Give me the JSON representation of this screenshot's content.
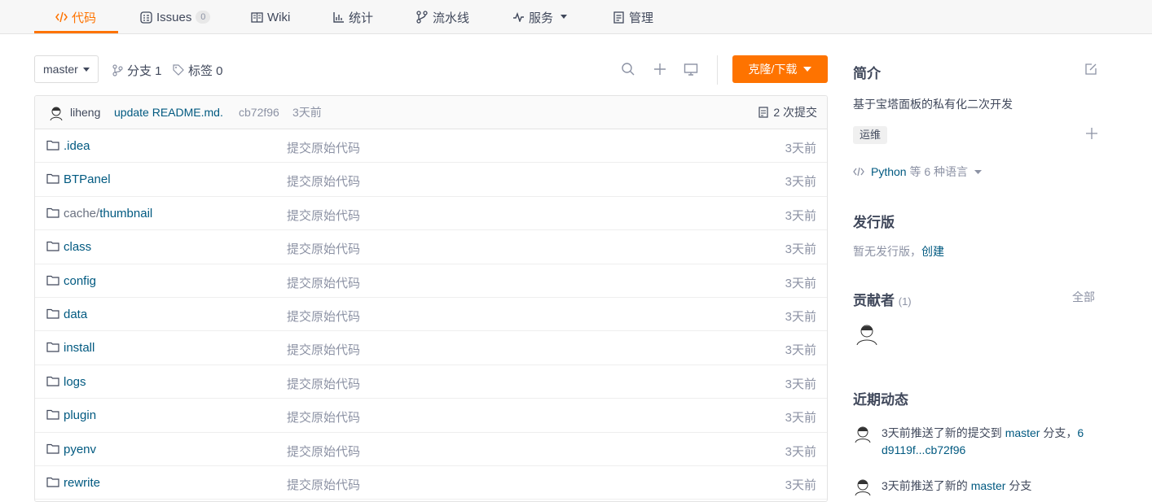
{
  "tabs": [
    {
      "label": "代码",
      "icon": "code-icon",
      "active": true
    },
    {
      "label": "Issues",
      "icon": "issues-icon",
      "badge": "0"
    },
    {
      "label": "Wiki",
      "icon": "wiki-icon"
    },
    {
      "label": "统计",
      "icon": "stats-icon"
    },
    {
      "label": "流水线",
      "icon": "pipeline-icon"
    },
    {
      "label": "服务",
      "icon": "service-icon",
      "dropdown": true
    },
    {
      "label": "管理",
      "icon": "manage-icon"
    }
  ],
  "toolbar": {
    "branch": "master",
    "branches_label": "分支 1",
    "tags_label": "标签 0",
    "clone_label": "克隆/下载"
  },
  "commit": {
    "author": "liheng",
    "message": "update README.md.",
    "sha": "cb72f96",
    "time": "3天前",
    "count_label": "2 次提交"
  },
  "files": [
    {
      "name": ".idea",
      "prefix": "",
      "message": "提交原始代码",
      "time": "3天前"
    },
    {
      "name": "BTPanel",
      "prefix": "",
      "message": "提交原始代码",
      "time": "3天前"
    },
    {
      "name": "thumbnail",
      "prefix": "cache/",
      "message": "提交原始代码",
      "time": "3天前"
    },
    {
      "name": "class",
      "prefix": "",
      "message": "提交原始代码",
      "time": "3天前"
    },
    {
      "name": "config",
      "prefix": "",
      "message": "提交原始代码",
      "time": "3天前"
    },
    {
      "name": "data",
      "prefix": "",
      "message": "提交原始代码",
      "time": "3天前"
    },
    {
      "name": "install",
      "prefix": "",
      "message": "提交原始代码",
      "time": "3天前"
    },
    {
      "name": "logs",
      "prefix": "",
      "message": "提交原始代码",
      "time": "3天前"
    },
    {
      "name": "plugin",
      "prefix": "",
      "message": "提交原始代码",
      "time": "3天前"
    },
    {
      "name": "pyenv",
      "prefix": "",
      "message": "提交原始代码",
      "time": "3天前"
    },
    {
      "name": "rewrite",
      "prefix": "",
      "message": "提交原始代码",
      "time": "3天前"
    }
  ],
  "sidebar": {
    "intro_title": "简介",
    "intro_text": "基于宝塔面板的私有化二次开发",
    "tag": "运维",
    "language_primary": "Python",
    "language_rest": "等 6 种语言",
    "release_title": "发行版",
    "release_none": "暂无发行版，",
    "release_create": "创建",
    "contributors_title": "贡献者",
    "contributors_count": "(1)",
    "contributors_all": "全部",
    "activity_title": "近期动态",
    "activities": [
      {
        "prefix": "3天前推送了新的提交到 ",
        "branch": "master",
        "middle": " 分支，",
        "range_a": "6",
        "range_b": "d9119f...cb72f96"
      },
      {
        "prefix": "3天前推送了新的 ",
        "branch": "master",
        "middle": " 分支"
      }
    ]
  },
  "colors": {
    "accent": "#fe7300",
    "link": "#005980",
    "muted": "#8c92a4",
    "text": "#40485b"
  }
}
